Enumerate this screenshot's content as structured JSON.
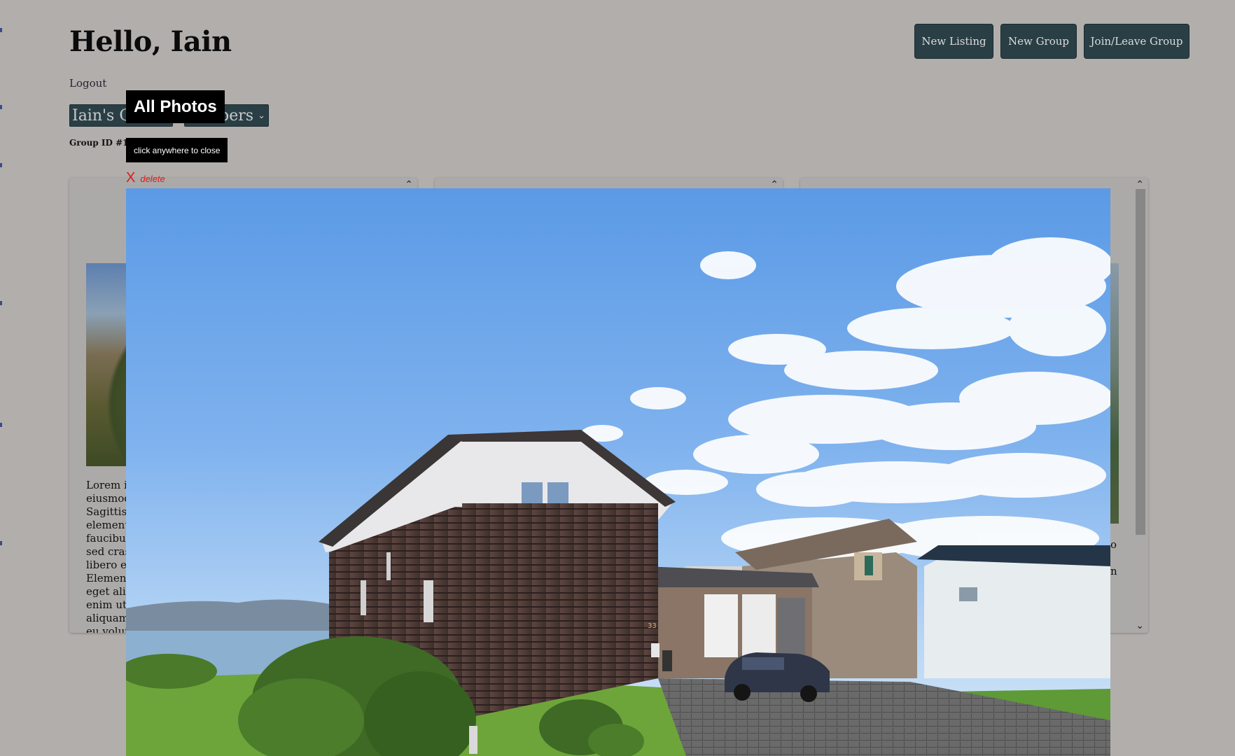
{
  "header": {
    "greeting": "Hello, Iain",
    "logout_label": "Logout",
    "buttons": {
      "new_listing": "New Listing",
      "new_group": "New Group",
      "join_leave_group": "Join/Leave Group"
    }
  },
  "group_select": {
    "selected_value": "Iain's Group",
    "visible_fragment": "Iain's Gr"
  },
  "members_select": {
    "selected_value": "Members",
    "visible_fragment": "bers"
  },
  "group_id_label": "Group ID #15",
  "listings": [
    {
      "description_lines": [
        "Lorem ip",
        "eiusmod",
        "Sagittis e",
        "element",
        "faucibus",
        "sed cras",
        "libero en",
        "Element",
        "eget aliq",
        "enim ut",
        "aliquam",
        "eu volut"
      ]
    },
    {
      "description_lines": []
    },
    {
      "description_lines": [
        "o",
        "n"
      ]
    }
  ],
  "modal": {
    "title": "All Photos",
    "hint": "click anywhere to close",
    "delete_x": "X",
    "delete_label": "delete",
    "photo_house_number": "33"
  },
  "colors": {
    "page_background": "#b1aeac",
    "button_background": "#2a3f45",
    "button_text": "#dcdcdc",
    "delete_red": "#e01818",
    "modal_label_bg": "#000000"
  },
  "icons": {
    "select_chevron": "chevron-down-icon",
    "panel_scroll_up": "chevron-up-icon",
    "panel_scroll_down": "chevron-down-icon",
    "delete": "close-icon"
  }
}
